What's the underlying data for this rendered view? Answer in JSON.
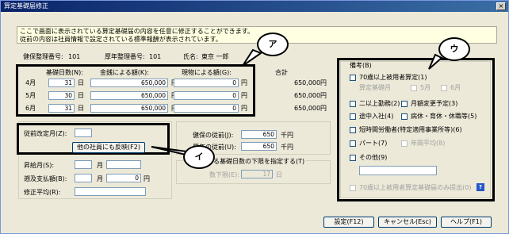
{
  "window": {
    "title": "算定基礎届修正",
    "close": "×"
  },
  "notice": {
    "line1": "ここで画面に表示されている算定基礎届の内容を任意に修正することができます。",
    "line2": "従前の内容は社員情報で設定されている標準報酬が表示されています。"
  },
  "header": {
    "health_no_label": "健保整理番号:",
    "health_no": "101",
    "pension_no_label": "厚年整理番号:",
    "pension_no": "101",
    "name_label": "氏名:",
    "name": "東京 一郎"
  },
  "table": {
    "col_days": "基礎日数(N):",
    "col_cash": "金銭による額(K):",
    "col_kind": "現物による額(G):",
    "col_total": "合計",
    "rows": [
      {
        "month": "4月",
        "days": "31",
        "days_unit": "日",
        "cash": "650,000",
        "cash_unit": "円",
        "kind": "0",
        "kind_unit": "円",
        "total": "650,000",
        "total_unit": "円"
      },
      {
        "month": "5月",
        "days": "30",
        "days_unit": "日",
        "cash": "650,000",
        "cash_unit": "円",
        "kind": "0",
        "kind_unit": "円",
        "total": "650,000",
        "total_unit": "円"
      },
      {
        "month": "6月",
        "days": "31",
        "days_unit": "日",
        "cash": "650,000",
        "cash_unit": "円",
        "kind": "0",
        "kind_unit": "円",
        "total": "650,000",
        "total_unit": "円"
      }
    ]
  },
  "prev": {
    "revision_label": "従前改定月(Z):",
    "reflect_button": "他の社員にも反映(F2)",
    "raise_label": "昇給月(S):",
    "raise_unit": "月",
    "retro_label": "遡及支払額(B):",
    "retro_month_unit": "月",
    "retro_amount": "0",
    "retro_amount_unit": "円",
    "avg_label": "修正平均(R):",
    "health_prev_label": "健保の従前(J):",
    "health_prev": "650",
    "health_prev_unit": "千円",
    "pension_prev_label": "厚年の従前(U):",
    "pension_prev": "650",
    "pension_prev_unit": "千円"
  },
  "limit": {
    "title": "する基礎日数の下限を指定する(T)",
    "lower_label": "数下限(E):",
    "lower_value": "17",
    "lower_unit": "日"
  },
  "remarks": {
    "title": "備考(B)",
    "over70": "70歳以上被用者算定(1)",
    "calc_month": "算定基礎月",
    "m5": "5月",
    "m6": "6月",
    "two_or_more": "二以上勤務(2)",
    "monthly_change": "月額変更予定(3)",
    "mid_join": "途中入社(4)",
    "leave": "病休・育休・休職等(5)",
    "short_time": "短時間労働者(特定適用事業所等)(6)",
    "part": "パート(7)",
    "annual_avg": "年間平均(8)",
    "other": "その他(9)",
    "over70_only": "70歳以上被用者算定基礎届のみ提出(0)",
    "help": "?"
  },
  "buttons": {
    "ok": "設定(F12)",
    "cancel": "キャンセル(Esc)",
    "help": "ヘルプ(F1)"
  },
  "callouts": {
    "a": "ア",
    "i": "イ",
    "u": "ウ"
  }
}
